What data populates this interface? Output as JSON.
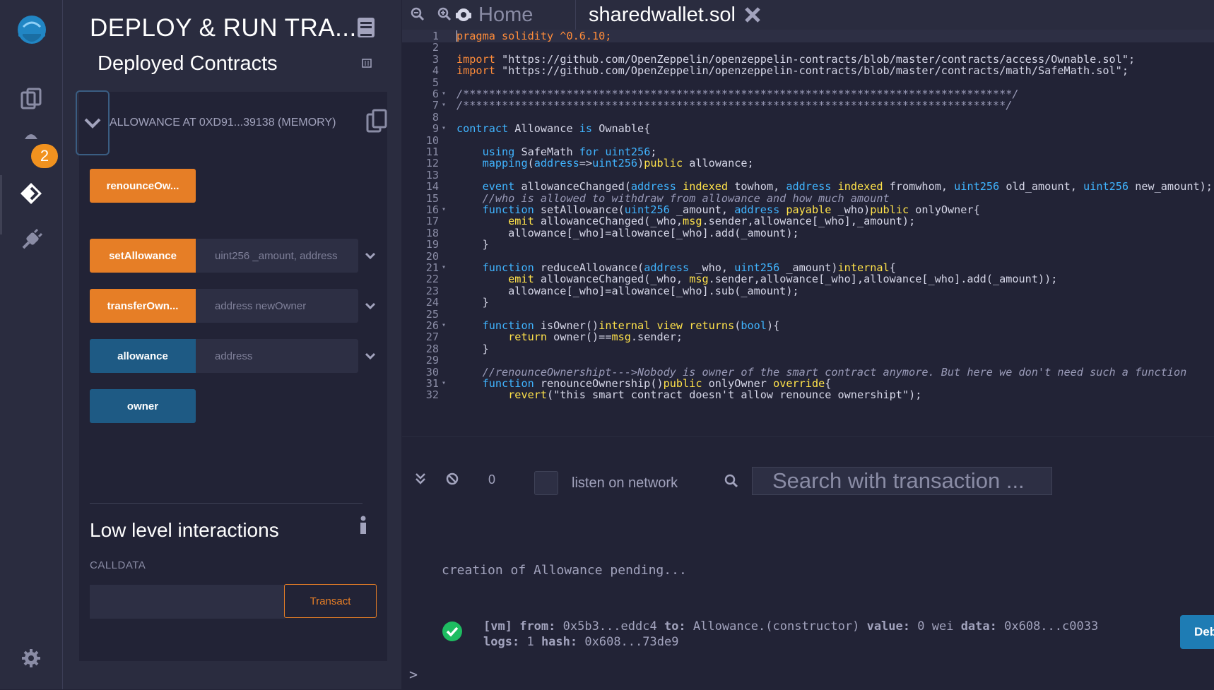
{
  "rail": {
    "badge_count": "2"
  },
  "panel": {
    "title": "DEPLOY & RUN TRA...",
    "deployed_header": "Deployed Contracts",
    "instance_title": "ALLOWANCE AT 0XD91...39138 (MEMORY)",
    "functions": [
      {
        "label": "renounceOw...",
        "placeholder": ""
      },
      {
        "label": "setAllowance",
        "placeholder": "uint256 _amount, address"
      },
      {
        "label": "transferOwn...",
        "placeholder": "address newOwner"
      },
      {
        "label": "allowance",
        "placeholder": "address"
      },
      {
        "label": "owner",
        "placeholder": ""
      }
    ],
    "low_level_title": "Low level interactions",
    "calldata_label": "CALLDATA",
    "transact_label": "Transact"
  },
  "tabs": {
    "home": "Home",
    "file": "sharedwallet.sol"
  },
  "editor": {
    "lines": [
      "pragma solidity ^0.6.10;",
      "",
      "import \"https://github.com/OpenZeppelin/openzeppelin-contracts/blob/master/contracts/access/Ownable.sol\";",
      "import \"https://github.com/OpenZeppelin/openzeppelin-contracts/blob/master/contracts/math/SafeMath.sol\";",
      "",
      "/*************************************************************************************/",
      "/************************************************************************************/",
      "",
      "contract Allowance is Ownable{",
      "",
      "    using SafeMath for uint256;",
      "    mapping(address=>uint256)public allowance;",
      "",
      "    event allowanceChanged(address indexed towhom, address indexed fromwhom, uint256 old_amount, uint256 new_amount);",
      "    //who is allowed to withdraw from allowance and how much amount",
      "    function setAllowance(uint256 _amount, address payable _who)public onlyOwner{",
      "        emit allowanceChanged(_who,msg.sender,allowance[_who],_amount);",
      "        allowance[_who]=allowance[_who].add(_amount);",
      "    }",
      "",
      "    function reduceAllowance(address _who, uint256 _amount)internal{",
      "        emit allowanceChanged(_who, msg.sender,allowance[_who],allowance[_who].add(_amount));",
      "        allowance[_who]=allowance[_who].sub(_amount);",
      "    }",
      "",
      "    function isOwner()internal view returns(bool){",
      "        return owner()==msg.sender;",
      "    }",
      "",
      "    //renounceOwnershipt--->Nobody is owner of the smart contract anymore. But here we don't need such a function",
      "    function renounceOwnership()public onlyOwner override{",
      "        revert(\"this smart contract doesn't allow renounce ownershipt\");"
    ]
  },
  "terminal": {
    "count": "0",
    "listen_label": "listen on network",
    "search_placeholder": "Search with transaction ...",
    "pending": "creation of Allowance pending...",
    "tx": {
      "tag": "[vm]",
      "from_label": "from:",
      "from": "0x5b3...eddc4",
      "to_label": "to:",
      "to": "Allowance.(constructor)",
      "value_label": "value:",
      "value": "0 wei",
      "data_label": "data:",
      "data": "0x608...c0033",
      "logs_label": "logs:",
      "logs": "1",
      "hash_label": "hash:",
      "hash": "0x608...73de9"
    },
    "debug_label": "Debug",
    "prompt": ">"
  },
  "colors": {
    "accent_orange": "#e67e26",
    "accent_blue": "#1e5a84",
    "success_green": "#1ebc61"
  }
}
